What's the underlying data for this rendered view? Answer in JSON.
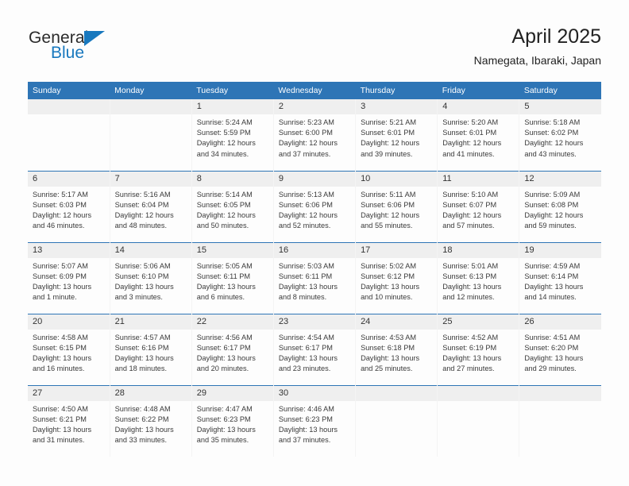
{
  "brand": {
    "name_primary": "General",
    "name_secondary": "Blue",
    "accent_color": "#1878be"
  },
  "header": {
    "title": "April 2025",
    "subtitle": "Namegata, Ibaraki, Japan"
  },
  "theme": {
    "header_row_color": "#2e75b6",
    "day_band_color": "#efefef",
    "text_color": "#3a3a3a"
  },
  "weekday_headers": [
    "Sunday",
    "Monday",
    "Tuesday",
    "Wednesday",
    "Thursday",
    "Friday",
    "Saturday"
  ],
  "weeks": [
    [
      {
        "day": "",
        "sunrise": "",
        "sunset": "",
        "daylight_1": "",
        "daylight_2": "",
        "empty": true
      },
      {
        "day": "",
        "sunrise": "",
        "sunset": "",
        "daylight_1": "",
        "daylight_2": "",
        "empty": true
      },
      {
        "day": "1",
        "sunrise": "Sunrise: 5:24 AM",
        "sunset": "Sunset: 5:59 PM",
        "daylight_1": "Daylight: 12 hours",
        "daylight_2": "and 34 minutes."
      },
      {
        "day": "2",
        "sunrise": "Sunrise: 5:23 AM",
        "sunset": "Sunset: 6:00 PM",
        "daylight_1": "Daylight: 12 hours",
        "daylight_2": "and 37 minutes."
      },
      {
        "day": "3",
        "sunrise": "Sunrise: 5:21 AM",
        "sunset": "Sunset: 6:01 PM",
        "daylight_1": "Daylight: 12 hours",
        "daylight_2": "and 39 minutes."
      },
      {
        "day": "4",
        "sunrise": "Sunrise: 5:20 AM",
        "sunset": "Sunset: 6:01 PM",
        "daylight_1": "Daylight: 12 hours",
        "daylight_2": "and 41 minutes."
      },
      {
        "day": "5",
        "sunrise": "Sunrise: 5:18 AM",
        "sunset": "Sunset: 6:02 PM",
        "daylight_1": "Daylight: 12 hours",
        "daylight_2": "and 43 minutes."
      }
    ],
    [
      {
        "day": "6",
        "sunrise": "Sunrise: 5:17 AM",
        "sunset": "Sunset: 6:03 PM",
        "daylight_1": "Daylight: 12 hours",
        "daylight_2": "and 46 minutes."
      },
      {
        "day": "7",
        "sunrise": "Sunrise: 5:16 AM",
        "sunset": "Sunset: 6:04 PM",
        "daylight_1": "Daylight: 12 hours",
        "daylight_2": "and 48 minutes."
      },
      {
        "day": "8",
        "sunrise": "Sunrise: 5:14 AM",
        "sunset": "Sunset: 6:05 PM",
        "daylight_1": "Daylight: 12 hours",
        "daylight_2": "and 50 minutes."
      },
      {
        "day": "9",
        "sunrise": "Sunrise: 5:13 AM",
        "sunset": "Sunset: 6:06 PM",
        "daylight_1": "Daylight: 12 hours",
        "daylight_2": "and 52 minutes."
      },
      {
        "day": "10",
        "sunrise": "Sunrise: 5:11 AM",
        "sunset": "Sunset: 6:06 PM",
        "daylight_1": "Daylight: 12 hours",
        "daylight_2": "and 55 minutes."
      },
      {
        "day": "11",
        "sunrise": "Sunrise: 5:10 AM",
        "sunset": "Sunset: 6:07 PM",
        "daylight_1": "Daylight: 12 hours",
        "daylight_2": "and 57 minutes."
      },
      {
        "day": "12",
        "sunrise": "Sunrise: 5:09 AM",
        "sunset": "Sunset: 6:08 PM",
        "daylight_1": "Daylight: 12 hours",
        "daylight_2": "and 59 minutes."
      }
    ],
    [
      {
        "day": "13",
        "sunrise": "Sunrise: 5:07 AM",
        "sunset": "Sunset: 6:09 PM",
        "daylight_1": "Daylight: 13 hours",
        "daylight_2": "and 1 minute."
      },
      {
        "day": "14",
        "sunrise": "Sunrise: 5:06 AM",
        "sunset": "Sunset: 6:10 PM",
        "daylight_1": "Daylight: 13 hours",
        "daylight_2": "and 3 minutes."
      },
      {
        "day": "15",
        "sunrise": "Sunrise: 5:05 AM",
        "sunset": "Sunset: 6:11 PM",
        "daylight_1": "Daylight: 13 hours",
        "daylight_2": "and 6 minutes."
      },
      {
        "day": "16",
        "sunrise": "Sunrise: 5:03 AM",
        "sunset": "Sunset: 6:11 PM",
        "daylight_1": "Daylight: 13 hours",
        "daylight_2": "and 8 minutes."
      },
      {
        "day": "17",
        "sunrise": "Sunrise: 5:02 AM",
        "sunset": "Sunset: 6:12 PM",
        "daylight_1": "Daylight: 13 hours",
        "daylight_2": "and 10 minutes."
      },
      {
        "day": "18",
        "sunrise": "Sunrise: 5:01 AM",
        "sunset": "Sunset: 6:13 PM",
        "daylight_1": "Daylight: 13 hours",
        "daylight_2": "and 12 minutes."
      },
      {
        "day": "19",
        "sunrise": "Sunrise: 4:59 AM",
        "sunset": "Sunset: 6:14 PM",
        "daylight_1": "Daylight: 13 hours",
        "daylight_2": "and 14 minutes."
      }
    ],
    [
      {
        "day": "20",
        "sunrise": "Sunrise: 4:58 AM",
        "sunset": "Sunset: 6:15 PM",
        "daylight_1": "Daylight: 13 hours",
        "daylight_2": "and 16 minutes."
      },
      {
        "day": "21",
        "sunrise": "Sunrise: 4:57 AM",
        "sunset": "Sunset: 6:16 PM",
        "daylight_1": "Daylight: 13 hours",
        "daylight_2": "and 18 minutes."
      },
      {
        "day": "22",
        "sunrise": "Sunrise: 4:56 AM",
        "sunset": "Sunset: 6:17 PM",
        "daylight_1": "Daylight: 13 hours",
        "daylight_2": "and 20 minutes."
      },
      {
        "day": "23",
        "sunrise": "Sunrise: 4:54 AM",
        "sunset": "Sunset: 6:17 PM",
        "daylight_1": "Daylight: 13 hours",
        "daylight_2": "and 23 minutes."
      },
      {
        "day": "24",
        "sunrise": "Sunrise: 4:53 AM",
        "sunset": "Sunset: 6:18 PM",
        "daylight_1": "Daylight: 13 hours",
        "daylight_2": "and 25 minutes."
      },
      {
        "day": "25",
        "sunrise": "Sunrise: 4:52 AM",
        "sunset": "Sunset: 6:19 PM",
        "daylight_1": "Daylight: 13 hours",
        "daylight_2": "and 27 minutes."
      },
      {
        "day": "26",
        "sunrise": "Sunrise: 4:51 AM",
        "sunset": "Sunset: 6:20 PM",
        "daylight_1": "Daylight: 13 hours",
        "daylight_2": "and 29 minutes."
      }
    ],
    [
      {
        "day": "27",
        "sunrise": "Sunrise: 4:50 AM",
        "sunset": "Sunset: 6:21 PM",
        "daylight_1": "Daylight: 13 hours",
        "daylight_2": "and 31 minutes."
      },
      {
        "day": "28",
        "sunrise": "Sunrise: 4:48 AM",
        "sunset": "Sunset: 6:22 PM",
        "daylight_1": "Daylight: 13 hours",
        "daylight_2": "and 33 minutes."
      },
      {
        "day": "29",
        "sunrise": "Sunrise: 4:47 AM",
        "sunset": "Sunset: 6:23 PM",
        "daylight_1": "Daylight: 13 hours",
        "daylight_2": "and 35 minutes."
      },
      {
        "day": "30",
        "sunrise": "Sunrise: 4:46 AM",
        "sunset": "Sunset: 6:23 PM",
        "daylight_1": "Daylight: 13 hours",
        "daylight_2": "and 37 minutes."
      },
      {
        "day": "",
        "sunrise": "",
        "sunset": "",
        "daylight_1": "",
        "daylight_2": "",
        "empty": true
      },
      {
        "day": "",
        "sunrise": "",
        "sunset": "",
        "daylight_1": "",
        "daylight_2": "",
        "empty": true
      },
      {
        "day": "",
        "sunrise": "",
        "sunset": "",
        "daylight_1": "",
        "daylight_2": "",
        "empty": true
      }
    ]
  ]
}
